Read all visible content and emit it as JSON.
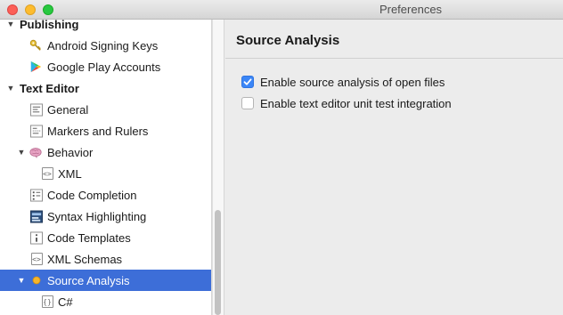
{
  "window": {
    "title": "Preferences"
  },
  "sidebar": {
    "items": [
      {
        "label": "Publishing",
        "icon": "none",
        "kind": "group",
        "expanded": true
      },
      {
        "label": "Android Signing Keys",
        "icon": "key-icon"
      },
      {
        "label": "Google Play Accounts",
        "icon": "google-play-icon"
      },
      {
        "label": "Text Editor",
        "icon": "none",
        "kind": "group",
        "expanded": true
      },
      {
        "label": "General",
        "icon": "general-settings-icon"
      },
      {
        "label": "Markers and Rulers",
        "icon": "markers-rulers-icon"
      },
      {
        "label": "Behavior",
        "icon": "brain-icon",
        "expanded": true
      },
      {
        "label": "XML",
        "icon": "xml-file-icon"
      },
      {
        "label": "Code Completion",
        "icon": "code-completion-icon"
      },
      {
        "label": "Syntax Highlighting",
        "icon": "syntax-highlighting-icon"
      },
      {
        "label": "Code Templates",
        "icon": "code-templates-icon"
      },
      {
        "label": "XML Schemas",
        "icon": "xml-schemas-icon"
      },
      {
        "label": "Source Analysis",
        "icon": "source-analysis-dot-icon",
        "expanded": true,
        "selected": true
      },
      {
        "label": "C#",
        "icon": "csharp-file-icon"
      }
    ]
  },
  "panel": {
    "title": "Source Analysis",
    "options": [
      {
        "label": "Enable source analysis of open files",
        "checked": true
      },
      {
        "label": "Enable text editor unit test integration",
        "checked": false
      }
    ]
  },
  "colors": {
    "selection": "#3d6ed8",
    "checkbox_accent": "#3b86f7",
    "close": "#fc5f57",
    "minimize": "#fdbc2e",
    "maximize": "#28c840"
  }
}
